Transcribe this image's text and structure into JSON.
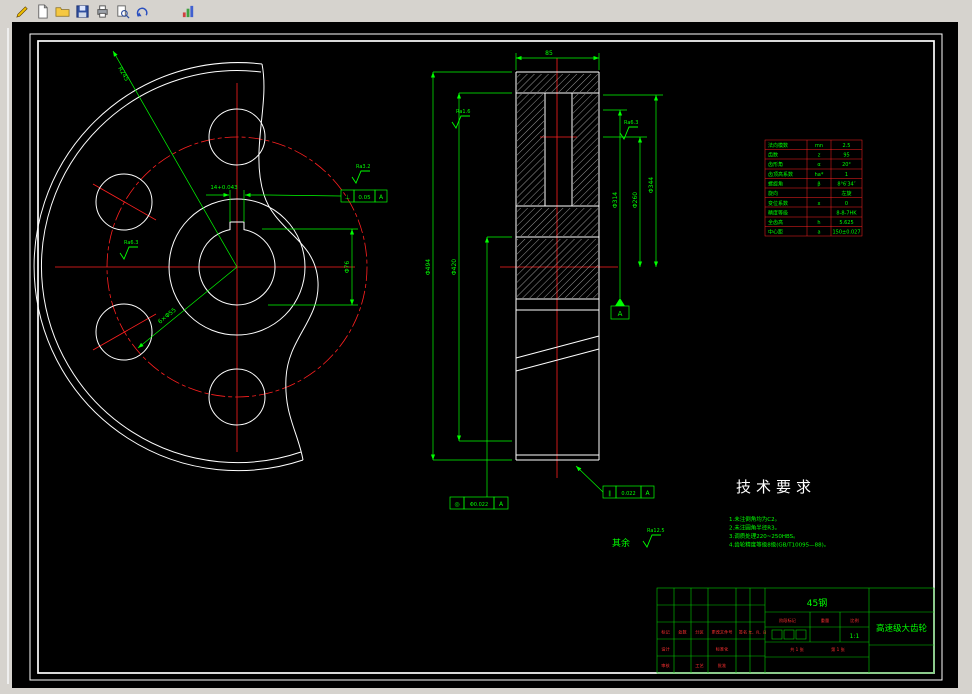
{
  "window": {
    "background": "#d6d3ce",
    "canvas": "#000000"
  },
  "toolbar": {
    "icons": [
      "draw-icon",
      "new-file-icon",
      "open-folder-icon",
      "save-icon",
      "print-icon",
      "preview-icon",
      "undo-icon",
      "plot-icon"
    ]
  },
  "colors": {
    "outline": "#ffffff",
    "centerline": "#ff2020",
    "dimension": "#00ff00",
    "table_grid": "#ff2020"
  },
  "front_view": {
    "radius_label": "R245",
    "keyway_dim": "14+0.043",
    "bore_dim": "Φ76",
    "holes_dim": "6×Φ55",
    "tolerance": {
      "symbol": "⊥",
      "value": "0.05",
      "datum": "A"
    },
    "roughness_hub": "Ra6.3",
    "roughness_keyway": "Ra3.2"
  },
  "section_view": {
    "dim_tip": "Φ494",
    "dim_root": "Φ420",
    "dim_right_outer": "Φ344",
    "dim_hole_circle": "Φ260",
    "dim_right_inner": "Φ314",
    "dim_width": "85",
    "datum_label": "A",
    "tol_parallel": {
      "symbol": "∥",
      "value": "0.022",
      "datum": "A"
    },
    "tol_position": {
      "symbol": "◎",
      "value": "Φ0.022",
      "datum": "A"
    },
    "roughness_left": "Ra1.6",
    "roughness_right": "Ra6.3"
  },
  "param_table": {
    "rows": [
      [
        "法向模数",
        "mn",
        "2.5"
      ],
      [
        "齿数",
        "z",
        "95"
      ],
      [
        "齿形角",
        "α",
        "20°"
      ],
      [
        "齿顶高系数",
        "ha*",
        "1"
      ],
      [
        "螺旋角",
        "β",
        "8°6′34″"
      ],
      [
        "旋向",
        "",
        "左旋"
      ],
      [
        "变位系数",
        "x",
        "0"
      ],
      [
        "精度等级",
        "",
        "8-8-7HK"
      ],
      [
        "全齿高",
        "h",
        "5.625"
      ],
      [
        "中心距",
        "a",
        "150±0.027"
      ]
    ]
  },
  "tech_req": {
    "title": "技术要求",
    "items": [
      "1.未注倒角均为C2。",
      "2.未注圆角半径R3。",
      "3.调质处理220~250HBS。",
      "4.齿轮精度等级8级(GB/T10095—88)。"
    ]
  },
  "other_roughness": {
    "label": "其余",
    "value": "Ra12.5"
  },
  "title_block": {
    "material": "45钢",
    "part_name": "高速级大齿轮",
    "rev_headers": [
      "标记",
      "处数",
      "分区",
      "更改文件号",
      "签名",
      "年、月、日"
    ],
    "roles": {
      "design": "设计",
      "standard": "标准化",
      "check": "审核",
      "process": "工艺",
      "approve": "批准"
    },
    "stage_label": "阶段标记",
    "weight_label": "重量",
    "scale_label": "比例",
    "scale_value": "1:1",
    "sheet_total": "共 1 张",
    "sheet_no": "第 1 张"
  }
}
